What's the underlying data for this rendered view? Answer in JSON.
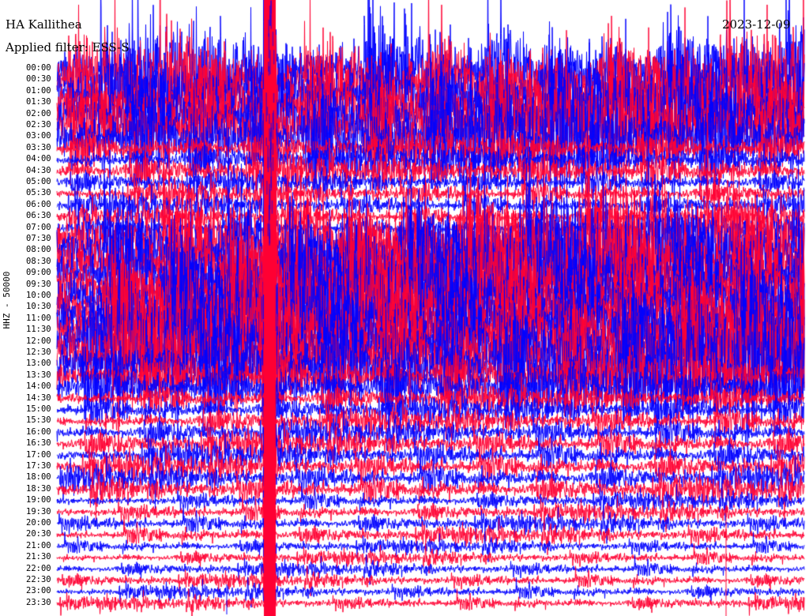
{
  "header": {
    "station": "HA Kallithea",
    "filter": "Applied filter: ESS-S",
    "date": "2023-12-09"
  },
  "chart_data": {
    "type": "line",
    "ylabel": "HHZ - 50000",
    "tick_labels": [
      "00:00",
      "00:30",
      "01:00",
      "01:30",
      "02:00",
      "02:30",
      "03:00",
      "03:30",
      "04:00",
      "04:30",
      "05:00",
      "05:30",
      "06:00",
      "06:30",
      "07:00",
      "07:30",
      "08:00",
      "08:30",
      "09:00",
      "09:30",
      "10:00",
      "10:30",
      "11:00",
      "11:30",
      "12:00",
      "12:30",
      "13:00",
      "13:30",
      "14:00",
      "14:30",
      "15:00",
      "15:30",
      "16:00",
      "16:30",
      "17:00",
      "17:30",
      "18:00",
      "18:30",
      "19:00",
      "19:30",
      "20:00",
      "20:30",
      "21:00",
      "21:30",
      "22:00",
      "22:30",
      "23:00",
      "23:30"
    ],
    "trace_colors": [
      "#ff0033",
      "#0000ff"
    ],
    "grid": false
  }
}
